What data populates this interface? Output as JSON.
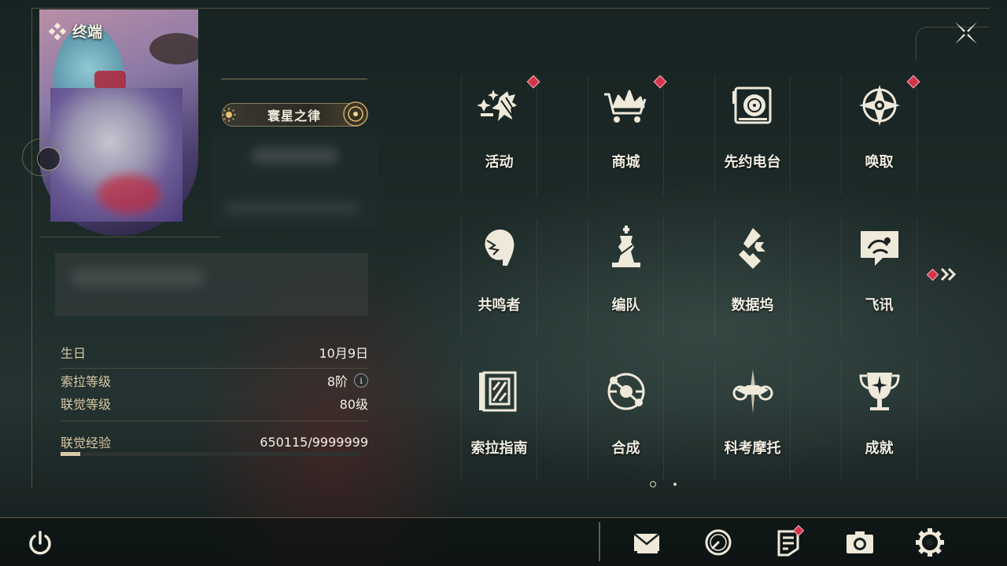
{
  "header": {
    "title": "终端"
  },
  "profile": {
    "title_badge": "寰星之律"
  },
  "stats": {
    "birthday": {
      "label": "生日",
      "value": "10月9日"
    },
    "sola_level": {
      "label": "索拉等级",
      "value": "8阶",
      "info_icon": "i"
    },
    "union_level": {
      "label": "联觉等级",
      "value": "80级"
    },
    "union_exp": {
      "label": "联觉经验",
      "value": "650115/9999999",
      "progress": 0.065
    }
  },
  "menu": {
    "items": [
      {
        "label": "活动",
        "icon": "events-icon",
        "notify": true
      },
      {
        "label": "商城",
        "icon": "shop-icon",
        "notify": true
      },
      {
        "label": "先约电台",
        "icon": "radio-icon",
        "notify": false
      },
      {
        "label": "唤取",
        "icon": "convene-icon",
        "notify": true
      },
      {
        "label": "共鸣者",
        "icon": "resonator-icon",
        "notify": false
      },
      {
        "label": "编队",
        "icon": "team-icon",
        "notify": false
      },
      {
        "label": "数据坞",
        "icon": "data-bank-icon",
        "notify": false
      },
      {
        "label": "飞讯",
        "icon": "chat-icon",
        "notify": false
      },
      {
        "label": "索拉指南",
        "icon": "guidebook-icon",
        "notify": false
      },
      {
        "label": "合成",
        "icon": "synthesis-icon",
        "notify": false
      },
      {
        "label": "科考摩托",
        "icon": "motorcycle-icon",
        "notify": false
      },
      {
        "label": "成就",
        "icon": "achievement-icon",
        "notify": false
      }
    ],
    "next_page_notify": true,
    "pages": {
      "current": 1,
      "total": 2
    }
  },
  "bottom_bar": {
    "icons": [
      "mail-icon",
      "clock-icon",
      "notice-icon",
      "camera-icon",
      "settings-icon"
    ],
    "notice_notify": true
  },
  "colors": {
    "accent_gold": "#d8c9a6",
    "notify_red": "#d4344a",
    "frame_line": "#8a7c5c"
  }
}
